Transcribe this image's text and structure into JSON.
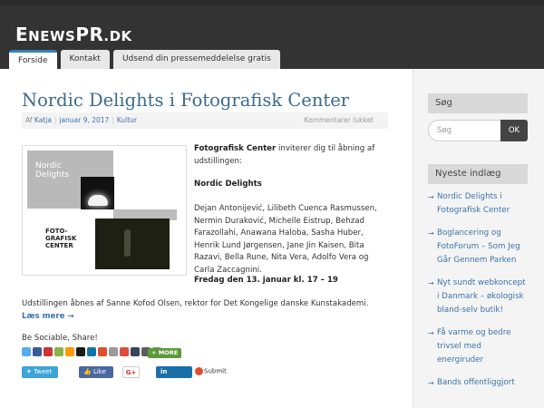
{
  "site": {
    "logo": "eNewsPR.dk",
    "logo_parts": [
      "E",
      "NEWS",
      "PR",
      ".DK"
    ]
  },
  "nav": {
    "tabs": [
      "Forside",
      "Kontakt",
      "Udsend din pressemeddelelse gratis"
    ],
    "active": "Forside"
  },
  "post": {
    "title": "Nordic Delights i Fotografisk Center",
    "meta": {
      "by_prefix": "Af",
      "author": "Katja",
      "date": "januar 9, 2017",
      "category": "Kultur",
      "comments": "Kommentarer lukket"
    },
    "image_text": {
      "top": "Nordic\nDelights",
      "bottom": "FOTO-\nGRAFISK\nCENTER"
    },
    "intro_bold": "Fotografisk Center",
    "intro_rest": " inviterer dig til åbning af udstillingen:",
    "exhibition": "Nordic Delights",
    "artists": "Dejan Antonijević, Lilibeth Cuenca Rasmussen, Nermin Duraković, Michelle Eistrup, Behzad Farazollahi, Anawana Haloba, Sasha Huber, Henrik Lund Jørgensen, Jane Jin Kaisen, Bita Razavi, Bella Rune, Nita Vera, Adolfo Vera og Carla Zaccagnini.",
    "when": "Fredag den 13. januar kl. 17 – 19",
    "opening": "Udstillingen åbnes af Sanne Kofod Olsen, rektor for Det Kongelige danske Kunstakademi.",
    "read_more": "Læs mere →"
  },
  "social": {
    "heading": "Be Sociable, Share!",
    "icon_colors": [
      "#55acee",
      "#3b5998",
      "#cc3333",
      "#8ab446",
      "#ff9900",
      "#1a1a1a",
      "#0e76a8",
      "#e04e2b",
      "#999999",
      "#dd4b39",
      "#35465c",
      "#5c5c5c",
      "#888888"
    ],
    "more": "MORE",
    "tweet": "Tweet",
    "like": "Like 0",
    "gplus": "G+",
    "share": "Share",
    "submit": "Submit"
  },
  "sidebar": {
    "search_title": "Søg",
    "search_placeholder": "Søg",
    "search_button": "OK",
    "recent_title": "Nyeste indlæg",
    "recent": [
      "Nordic Delights i Fotografisk Center",
      "Boglancering og FotoForum – Som Jeg Går Gennem Parken",
      "Nyt sundt webkoncept i Danmark – økologisk bland-selv butik!",
      "Få varme og bedre trivsel med energiruder",
      "Bands offentliggjort"
    ]
  },
  "colors": {
    "header": "#333333",
    "link": "#3b73a8",
    "title": "#3b6b8f",
    "tab_accent": "#3a7fb8"
  }
}
